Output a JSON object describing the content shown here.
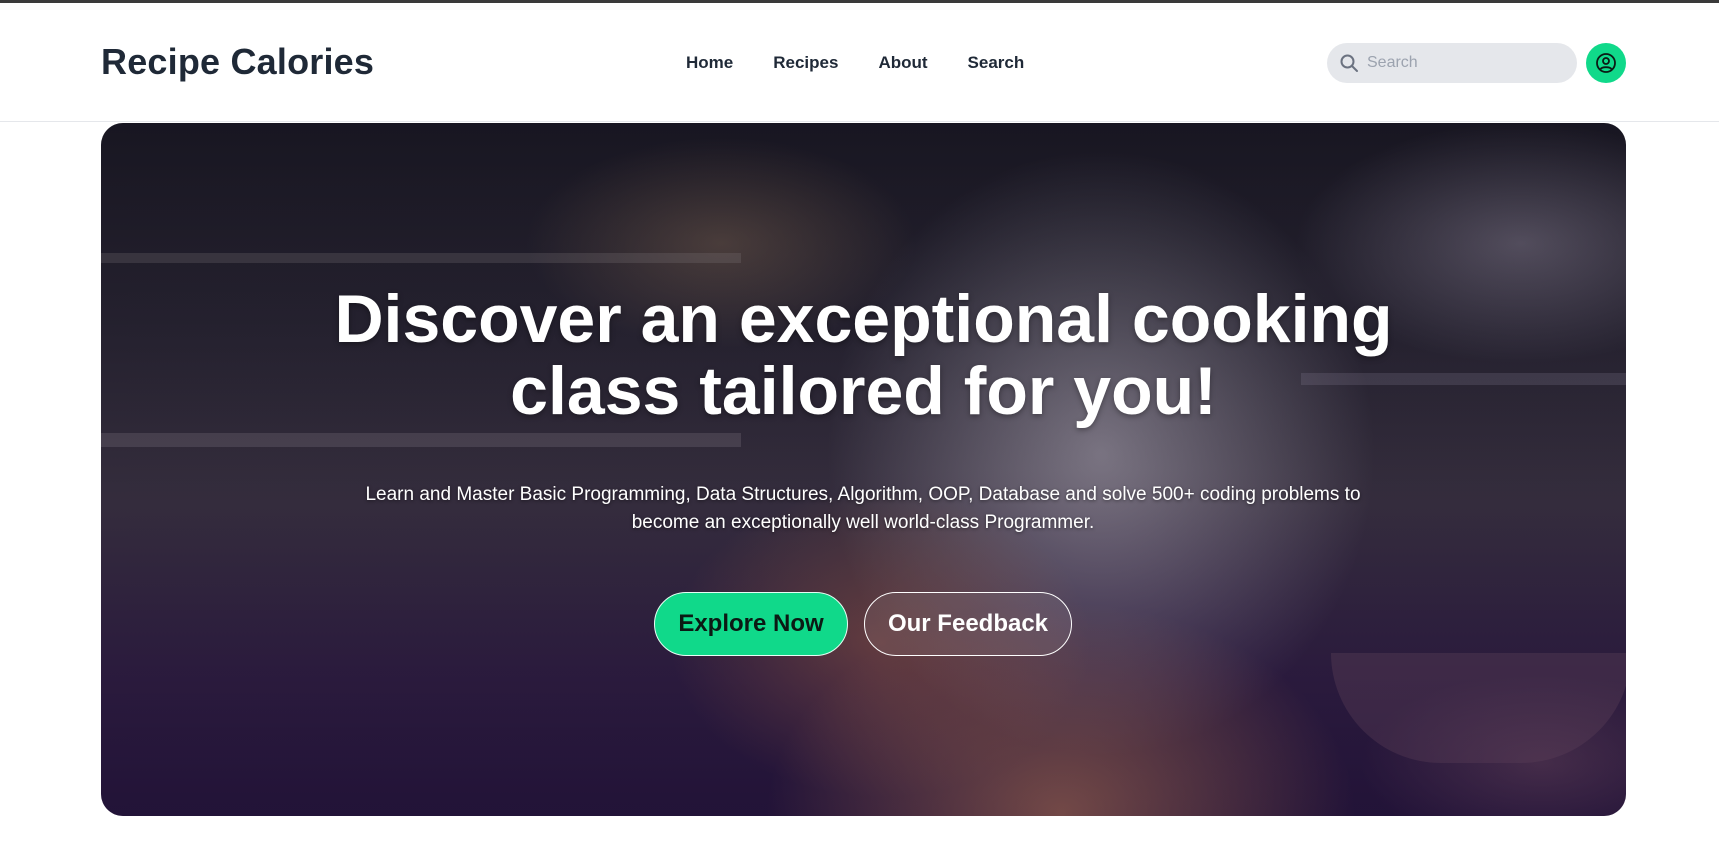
{
  "header": {
    "brand": "Recipe Calories",
    "nav": [
      {
        "label": "Home"
      },
      {
        "label": "Recipes"
      },
      {
        "label": "About"
      },
      {
        "label": "Search"
      }
    ],
    "search": {
      "placeholder": "Search",
      "value": ""
    },
    "avatar_icon": "user-circle-icon",
    "accent_color": "#10d98a"
  },
  "hero": {
    "title": "Discover an exceptional cooking class tailored for you!",
    "subtitle": "Learn and Master Basic Programming, Data Structures, Algorithm, OOP, Database and solve 500+ coding problems to become an exceptionally well world-class Programmer.",
    "primary_button": "Explore Now",
    "secondary_button": "Our Feedback"
  }
}
